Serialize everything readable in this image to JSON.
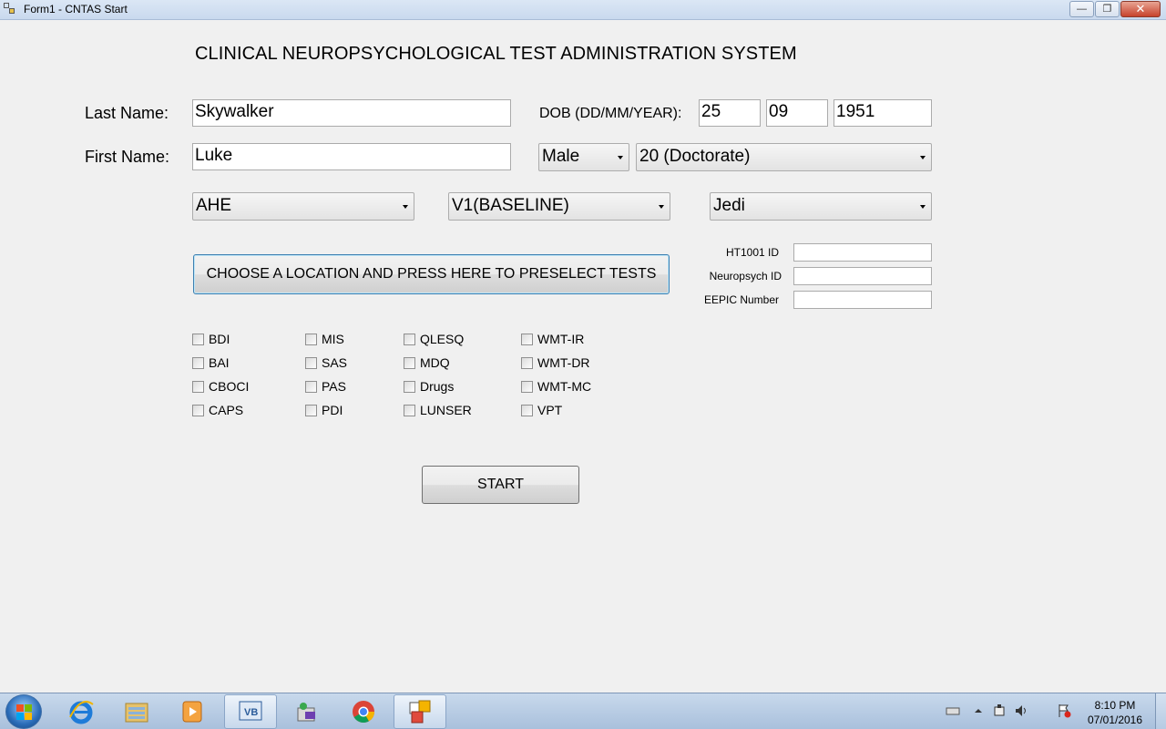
{
  "window": {
    "title": "Form1 - CNTAS Start",
    "minimize_glyph": "—",
    "restore_glyph": "❐",
    "close_glyph": "✕"
  },
  "heading": "CLINICAL NEUROPSYCHOLOGICAL TEST ADMINISTRATION SYSTEM",
  "form": {
    "last_name_label": "Last Name:",
    "last_name_value": "Skywalker",
    "first_name_label": "First Name:",
    "first_name_value": "Luke",
    "dob_label": "DOB (DD/MM/YEAR):",
    "dob_day": "25",
    "dob_month": "09",
    "dob_year": "1951",
    "gender": "Male",
    "education": "20 (Doctorate)",
    "location": "AHE",
    "visit": "V1(BASELINE)",
    "group": "Jedi",
    "ht1001_label": "HT1001 ID",
    "ht1001_value": "",
    "neuropsych_label": "Neuropsych ID",
    "neuropsych_value": "",
    "eepic_label": "EEPIC Number",
    "eepic_value": ""
  },
  "preselect_button": "CHOOSE A LOCATION AND PRESS HERE TO PRESELECT TESTS",
  "tests": {
    "col1": [
      "BDI",
      "BAI",
      "CBOCI",
      "CAPS"
    ],
    "col2": [
      "MIS",
      "SAS",
      "PAS",
      "PDI"
    ],
    "col3": [
      "QLESQ",
      "MDQ",
      "Drugs",
      "LUNSER"
    ],
    "col4": [
      "WMT-IR",
      "WMT-DR",
      "WMT-MC",
      "VPT"
    ]
  },
  "start_button": "START",
  "taskbar": {
    "apps": [
      "internet-explorer",
      "windows-explorer",
      "media-player",
      "visual-basic",
      "installer",
      "chrome",
      "form-app"
    ],
    "time": "8:10 PM",
    "date": "07/01/2016"
  }
}
